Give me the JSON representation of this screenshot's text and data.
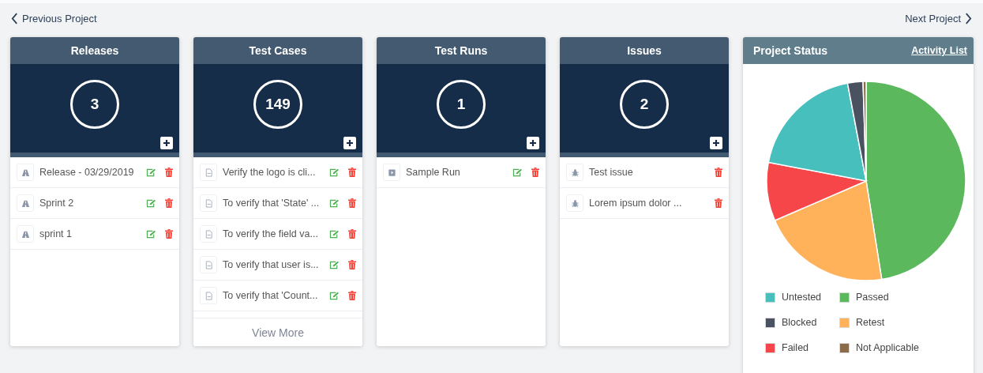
{
  "nav": {
    "previous": "Previous Project",
    "next": "Next Project"
  },
  "panels": [
    {
      "kind": "release",
      "title": "Releases",
      "count": "3",
      "items": [
        {
          "label": "Release - 03/29/2019",
          "editable": true
        },
        {
          "label": "Sprint 2",
          "editable": true
        },
        {
          "label": "sprint 1",
          "editable": true
        }
      ]
    },
    {
      "kind": "testcase",
      "title": "Test Cases",
      "count": "149",
      "items": [
        {
          "label": "Verify the logo is cli...",
          "editable": true
        },
        {
          "label": "To verify that 'State' ...",
          "editable": true
        },
        {
          "label": "To verify the field va...",
          "editable": true
        },
        {
          "label": "To verify that user is...",
          "editable": true
        },
        {
          "label": "To verify that 'Count...",
          "editable": true
        }
      ],
      "more": "View More"
    },
    {
      "kind": "run",
      "title": "Test Runs",
      "count": "1",
      "items": [
        {
          "label": "Sample Run",
          "editable": true
        }
      ]
    },
    {
      "kind": "issue",
      "title": "Issues",
      "count": "2",
      "items": [
        {
          "label": "Test issue",
          "editable": false
        },
        {
          "label": "Lorem ipsum dolor ...",
          "editable": false
        }
      ]
    }
  ],
  "status": {
    "title": "Project Status",
    "link": "Activity List",
    "legend": [
      {
        "label": "Untested",
        "color": "#47bfbd"
      },
      {
        "label": "Passed",
        "color": "#5cb85c"
      },
      {
        "label": "Blocked",
        "color": "#4a5160"
      },
      {
        "label": "Retest",
        "color": "#ffb25a"
      },
      {
        "label": "Failed",
        "color": "#f7464a"
      },
      {
        "label": "Not Applicable",
        "color": "#8b6c4a"
      }
    ]
  }
}
